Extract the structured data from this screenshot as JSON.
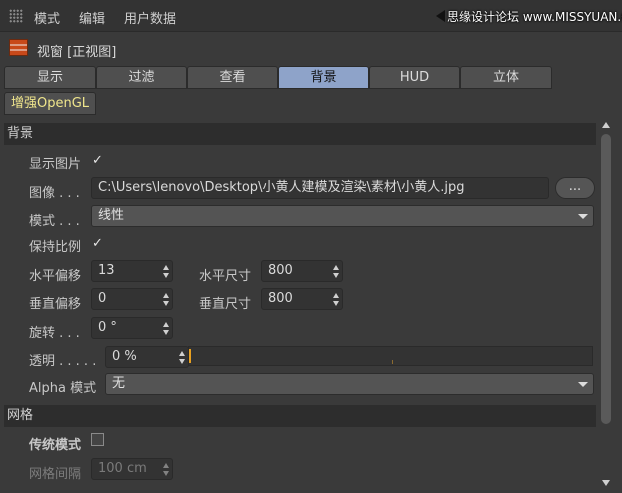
{
  "menu": {
    "items": [
      "模式",
      "编辑",
      "用户数据"
    ]
  },
  "watermark": "思缘设计论坛 www.MISSYUAN.COM",
  "title": "视窗 [正视图]",
  "tabs": [
    "显示",
    "过滤",
    "查看",
    "背景",
    "HUD",
    "立体"
  ],
  "active_tab": "背景",
  "tab_opengl": "增强OpenGL",
  "background": {
    "header": "背景",
    "show_image_label": "显示图片",
    "show_image_checked": true,
    "image_label": "图像 . . .",
    "image_path": "C:\\Users\\lenovo\\Desktop\\小黄人建模及渲染\\素材\\小黄人.jpg",
    "browse_label": "...",
    "mode_label": "模式 . . .",
    "mode_value": "线性",
    "keep_ratio_label": "保持比例",
    "keep_ratio_checked": true,
    "h_offset_label": "水平偏移",
    "h_offset_value": "13",
    "h_size_label": "水平尺寸",
    "h_size_value": "800",
    "v_offset_label": "垂直偏移",
    "v_offset_value": "0",
    "v_size_label": "垂直尺寸",
    "v_size_value": "800",
    "rotate_label": "旋转 . . .",
    "rotate_value": "0 °",
    "transparency_label": "透明 . . . . .",
    "transparency_value": "0 %",
    "transparency_fraction": 0.0,
    "alpha_label": "Alpha 模式",
    "alpha_value": "无"
  },
  "grid": {
    "header": "网格",
    "legacy_label": "传统模式",
    "legacy_checked": false,
    "spacing_label": "网格间隔",
    "spacing_value": "100 cm"
  },
  "check_glyph": "✓",
  "colors": {
    "active_tab": "#8ea3c9",
    "slider_fill": "#e8a020",
    "opengl_text": "#f0e68c"
  }
}
